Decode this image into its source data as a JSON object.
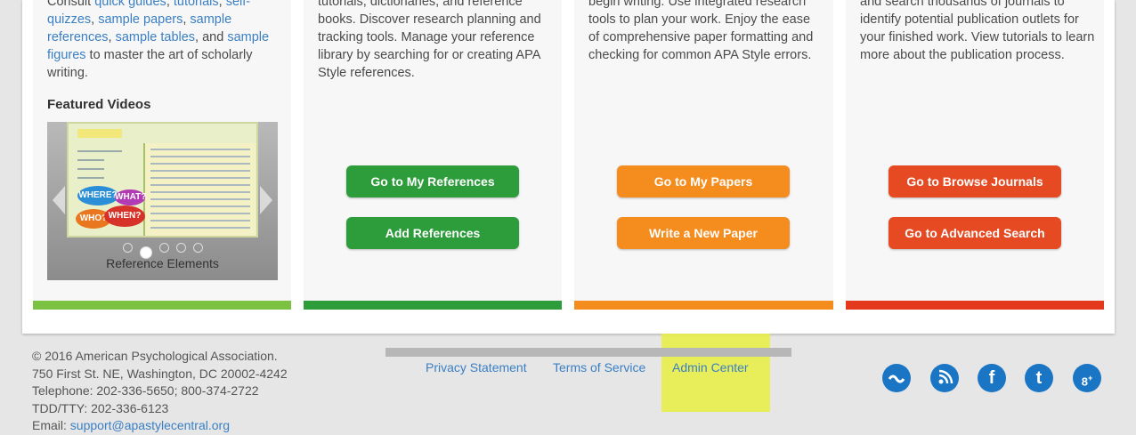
{
  "columns": [
    {
      "text_before": "Consult ",
      "inline_links": [
        "quick guides",
        "tutorials",
        "self-quizzes",
        "sample papers",
        "sample references",
        "sample tables",
        "sample figures"
      ],
      "text_after": " to master the art of scholarly writing.",
      "featured_heading": "Featured Videos",
      "video": {
        "caption": "Reference Elements",
        "bubbles": [
          "WHERE?",
          "WHAT?",
          "WHO?",
          "WHEN?"
        ],
        "slide_title": "Reference Elements"
      }
    },
    {
      "text": "tutorials, dictionaries, and reference books. Discover research planning and tracking tools. Manage your reference library by searching for or creating APA Style references.",
      "buttons": [
        "Go to My References",
        "Add References"
      ],
      "color": "#2d9c3b"
    },
    {
      "text": "begin writing. Use integrated research tools to plan your work. Enjoy the ease of comprehensive paper formatting and checking for common APA Style errors.",
      "buttons": [
        "Go to My Papers",
        "Write a New Paper"
      ],
      "color": "#f58c1e"
    },
    {
      "text": "and search thousands of journals to identify potential publication outlets for your finished work. View tutorials to learn more about the publication process.",
      "buttons": [
        "Go to Browse Journals",
        "Go to Advanced Search"
      ],
      "color": "#e54a22"
    }
  ],
  "bar_colors": [
    "#7cc242",
    "#2d9c3b",
    "#f58c1e",
    "#e5391e"
  ],
  "footer": {
    "copyright": "© 2016 American Psychological Association.",
    "address": "750 First St. NE, Washington, DC 20002-4242",
    "telephone": "Telephone: 202-336-5650; 800-374-2722",
    "tdd": "TDD/TTY: 202-336-6123",
    "email_label": "Email: ",
    "email": "support@apastylecentral.org",
    "links": [
      "Privacy Statement",
      "Terms of Service",
      "Admin Center"
    ]
  },
  "social_icons": [
    "apa-icon",
    "rss-icon",
    "facebook-icon",
    "twitter-icon",
    "google-plus-icon"
  ]
}
